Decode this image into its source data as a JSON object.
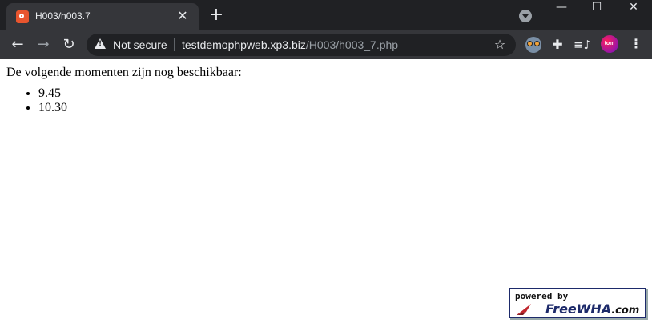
{
  "browser": {
    "tab": {
      "title": "H003/h003.7"
    },
    "address_bar": {
      "security_label": "Not secure",
      "url_host": "testdemophpweb.xp3.biz",
      "url_path": "/H003/h003_7.php"
    },
    "profile_initials": "tom"
  },
  "page": {
    "intro_text": "De volgende momenten zijn nog beschikbaar:",
    "available_times": [
      "9.45",
      "10.30"
    ]
  },
  "badge": {
    "top_text": "powered by",
    "brand": "FreeWHA",
    "suffix": ".com"
  },
  "icons": [
    "favicon-icon",
    "close-icon",
    "plus-icon",
    "chevron-down-icon",
    "minimize-icon",
    "maximize-icon",
    "close-window-icon",
    "back-arrow-icon",
    "forward-arrow-icon",
    "reload-icon",
    "warning-icon",
    "star-icon",
    "owl-extension-icon",
    "puzzle-icon",
    "media-control-icon",
    "kebab-menu-icon"
  ]
}
